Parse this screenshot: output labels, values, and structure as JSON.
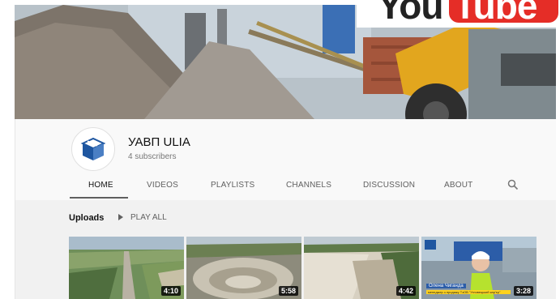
{
  "brand": {
    "you": "You",
    "tube": "Tube"
  },
  "channel": {
    "name": "УАВП ULIA",
    "subscribers": "4 subscribers"
  },
  "tabs": [
    "HOME",
    "VIDEOS",
    "PLAYLISTS",
    "CHANNELS",
    "DISCUSSION",
    "ABOUT"
  ],
  "active_tab": "HOME",
  "icons": {
    "search": "search-icon",
    "play": "play-icon",
    "avatar": "box-logo-icon"
  },
  "colors": {
    "youtube_red": "#e52d27",
    "header_bg": "#f9f9f9",
    "content_bg": "#f1f1f1",
    "logo_blue": "#1e56a0"
  },
  "uploads": {
    "title": "Uploads",
    "play_all": "PLAY ALL",
    "videos": [
      {
        "duration": "4:10"
      },
      {
        "duration": "5:58"
      },
      {
        "duration": "4:42"
      },
      {
        "duration": "3:28",
        "caption_name": "Олена Чиганда",
        "caption_role": "менеджер з продажу ТзОВ \"Угловецький кар'єр\""
      }
    ]
  }
}
